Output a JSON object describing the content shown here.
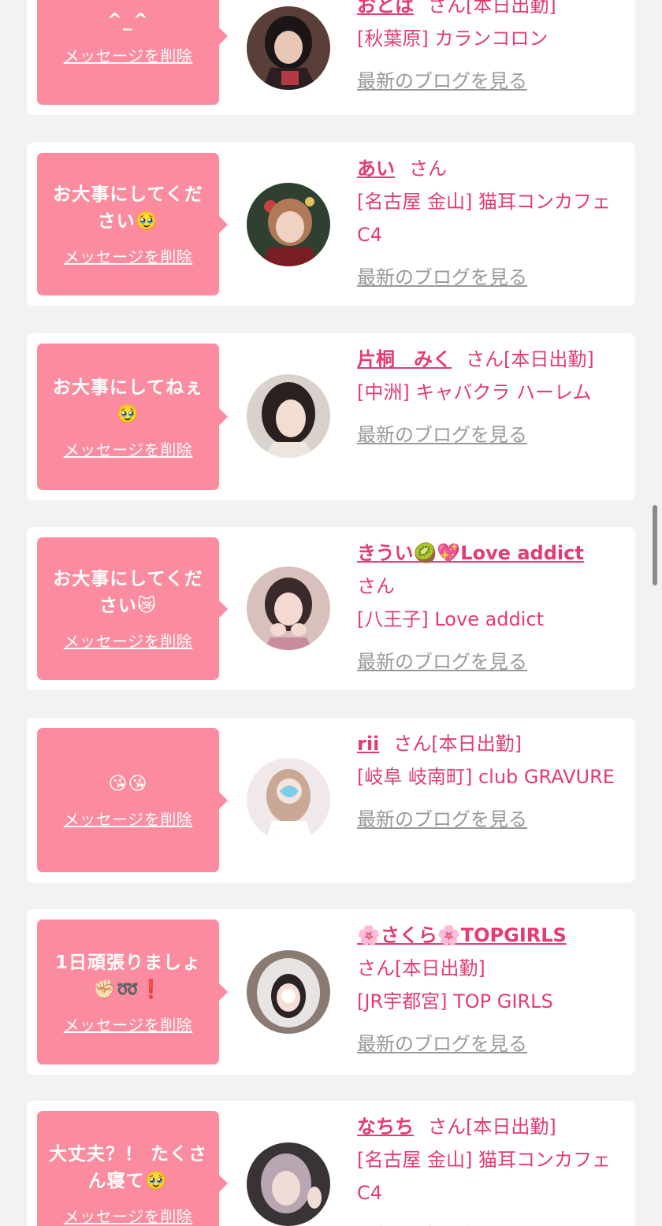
{
  "delete_label": "メッセージを削除",
  "blog_label": "最新のブログを見る",
  "colors": {
    "background": "#f2f2f2",
    "bubble": "#fb8b9f",
    "accent": "#e23c70",
    "muted_link": "#999999"
  },
  "cards": [
    {
      "message": "^_^",
      "name": "おとは",
      "suffix": "さん",
      "status": "[本日出勤]",
      "shop": "[秋葉原] カランコロン",
      "avatar_icon": "girl-photo-avatar"
    },
    {
      "message": "お大事にしてください🥹",
      "name": "あい",
      "suffix": "さん",
      "status": "",
      "shop": "[名古屋 金山] 猫耳コンカフェ C4",
      "avatar_icon": "girl-photo-avatar"
    },
    {
      "message": "お大事にしてねぇ🥹",
      "name": "片桐　みく",
      "suffix": "さん",
      "status": "[本日出勤]",
      "shop": "[中洲] キャバクラ ハーレム",
      "avatar_icon": "girl-photo-avatar"
    },
    {
      "message": "お大事にしてください😿",
      "name": "きうい🥝💖Love addict",
      "suffix": "さん",
      "status": "",
      "shop": "[八王子] Love addict",
      "avatar_icon": "girl-photo-avatar"
    },
    {
      "message": "😘😘",
      "name": "rii",
      "suffix": "さん",
      "status": "[本日出勤]",
      "shop": "[岐阜 岐南町] club GRAVURE",
      "avatar_icon": "girl-photo-avatar"
    },
    {
      "message": "1日頑張りましょ✊🏻➿❗️",
      "name": "🌸さくら🌸TOPGIRLS",
      "suffix": "さん",
      "status": "[本日出勤]",
      "shop": "[JR宇都宮] TOP GIRLS",
      "avatar_icon": "girl-photo-avatar"
    },
    {
      "message": "大丈夫？！ たくさん寝て🥹",
      "name": "なちち",
      "suffix": "さん",
      "status": "[本日出勤]",
      "shop": "[名古屋 金山] 猫耳コンカフェ C4",
      "avatar_icon": "girl-photo-avatar"
    }
  ]
}
